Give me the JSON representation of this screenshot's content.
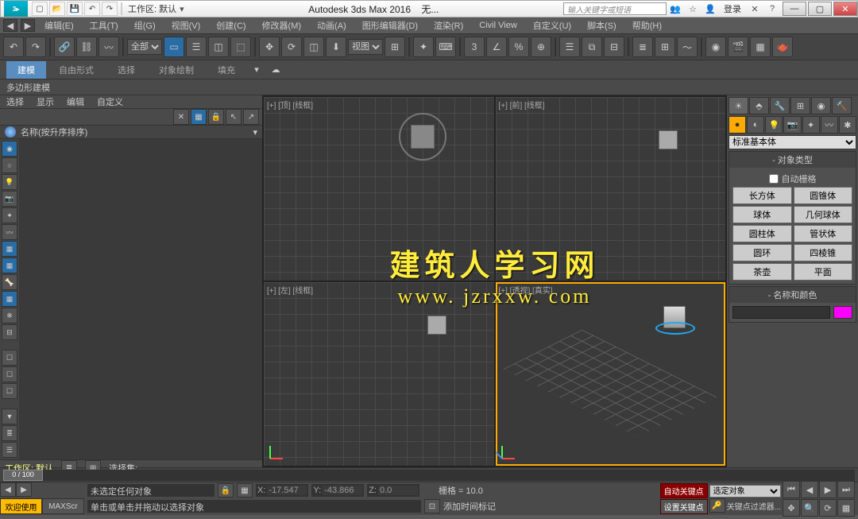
{
  "title": "Autodesk 3ds Max 2016",
  "title_suffix": "无...",
  "workspace_label": "工作区: 默认",
  "search_placeholder": "输入关键字或短语",
  "login_label": "登录",
  "menus": [
    "编辑(E)",
    "工具(T)",
    "组(G)",
    "视图(V)",
    "创建(C)",
    "修改器(M)",
    "动画(A)",
    "图形编辑器(D)",
    "渲染(R)",
    "Civil View",
    "自定义(U)",
    "脚本(S)",
    "帮助(H)"
  ],
  "toolbar_select_all": "全部",
  "toolbar_select_view": "视图",
  "ribbon_tabs": [
    "建模",
    "自由形式",
    "选择",
    "对象绘制",
    "填充"
  ],
  "subheader": "多边形建模",
  "left_tabs": [
    "选择",
    "显示",
    "编辑",
    "自定义"
  ],
  "list_header": "名称(按升序排序)",
  "workspace_status": "工作区: 默认",
  "select_set_label": "选择集:",
  "viewport_labels": {
    "top": "[+] [顶] [线框]",
    "front": "[+] [前] [线框]",
    "left": "[+] [左] [线框]",
    "persp": "[+] [透视] [真实]"
  },
  "watermark": {
    "line1": "建筑人学习网",
    "line2": "www. jzrxxw. com"
  },
  "right_dropdown": "标准基本体",
  "rollout_objtype": "对象类型",
  "autogrid_label": "自动栅格",
  "primitives": [
    [
      "长方体",
      "圆锥体"
    ],
    [
      "球体",
      "几何球体"
    ],
    [
      "圆柱体",
      "管状体"
    ],
    [
      "圆环",
      "四棱锥"
    ],
    [
      "茶壶",
      "平面"
    ]
  ],
  "rollout_namecolor": "名称和颜色",
  "timeline": {
    "current": 0,
    "total": 100,
    "display": "0 / 100"
  },
  "status": {
    "tab1": "欢迎使用",
    "tab2": "MAXScr",
    "no_selection": "未选定任何对象",
    "prompt": "单击或单击并拖动以选择对象",
    "x": "-17.547",
    "y": "-43.866",
    "z": "0.0",
    "grid": "栅格 = 10.0",
    "time_tag": "添加时间标记",
    "autokey": "自动关键点",
    "setkey": "设置关键点",
    "key_dropdown": "选定对象",
    "key_filter": "关键点过滤器..."
  }
}
